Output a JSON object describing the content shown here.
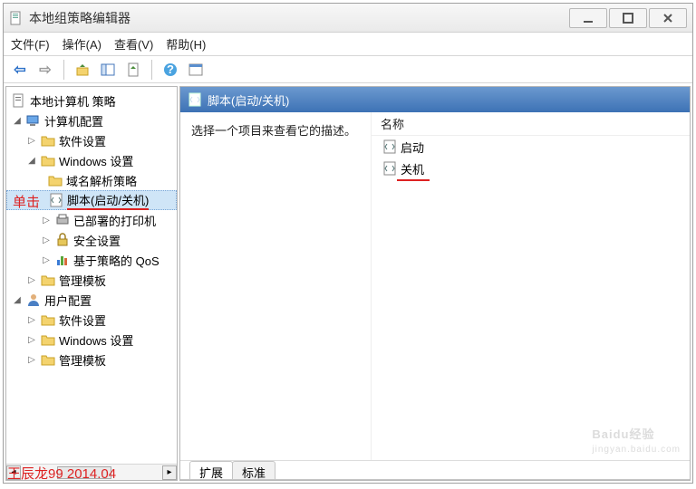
{
  "window": {
    "title": "本地组策略编辑器"
  },
  "menu": {
    "file": "文件(F)",
    "action": "操作(A)",
    "view": "查看(V)",
    "help": "帮助(H)"
  },
  "tree": {
    "root": "本地计算机 策略",
    "computer_cfg": "计算机配置",
    "software_settings_1": "软件设置",
    "windows_settings_1": "Windows 设置",
    "dns_policy": "域名解析策略",
    "scripts": "脚本(启动/关机)",
    "printers": "已部署的打印机",
    "security": "安全设置",
    "qos": "基于策略的 QoS",
    "admin_templates_1": "管理模板",
    "user_cfg": "用户配置",
    "software_settings_2": "软件设置",
    "windows_settings_2": "Windows 设置",
    "admin_templates_2": "管理模板"
  },
  "annotation": {
    "click": "单击"
  },
  "pane": {
    "header": "脚本(启动/关机)",
    "desc": "选择一个项目来查看它的描述。",
    "col_name": "名称",
    "item_startup": "启动",
    "item_shutdown": "关机"
  },
  "tabs": {
    "extended": "扩展",
    "standard": "标准"
  },
  "footer": {
    "credit": "王辰龙99 2014.04"
  },
  "watermark": {
    "brand": "Baidu经验",
    "url": "jingyan.baidu.com"
  }
}
